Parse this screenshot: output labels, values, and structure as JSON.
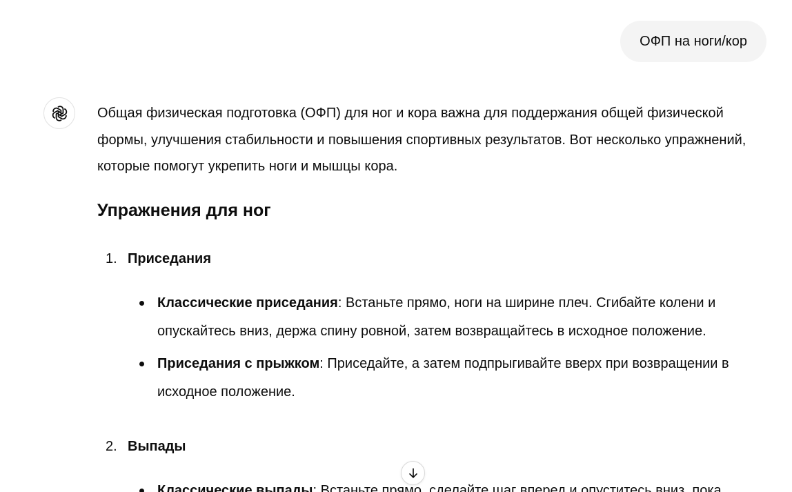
{
  "user_message": {
    "text": "ОФП на ноги/кор"
  },
  "assistant": {
    "avatar_icon": "openai-logo-icon",
    "intro": "Общая физическая подготовка (ОФП) для ног и кора важна для поддержания общей физической формы, улучшения стабильности и повышения спортивных результатов. Вот несколько упражнений, которые помогут укрепить ноги и мышцы кора.",
    "section_heading": "Упражнения для ног",
    "exercises": [
      {
        "number": "1.",
        "title": "Приседания",
        "items": [
          {
            "name": "Классические приседания",
            "text": ": Встаньте прямо, ноги на ширине плеч. Сгибайте колени и опускайтесь вниз, держа спину ровной, затем возвращайтесь в исходное положение."
          },
          {
            "name": "Приседания с прыжком",
            "text": ": Приседайте, а затем подпрыгивайте вверх при возвращении в исходное положение."
          }
        ]
      },
      {
        "number": "2.",
        "title": "Выпады",
        "items": [
          {
            "name": "Классические выпады",
            "text": ": Встаньте прямо, сделайте шаг вперед и опуститесь вниз, пока"
          }
        ]
      }
    ]
  },
  "scroll_button": {
    "icon": "arrow-down-icon"
  }
}
